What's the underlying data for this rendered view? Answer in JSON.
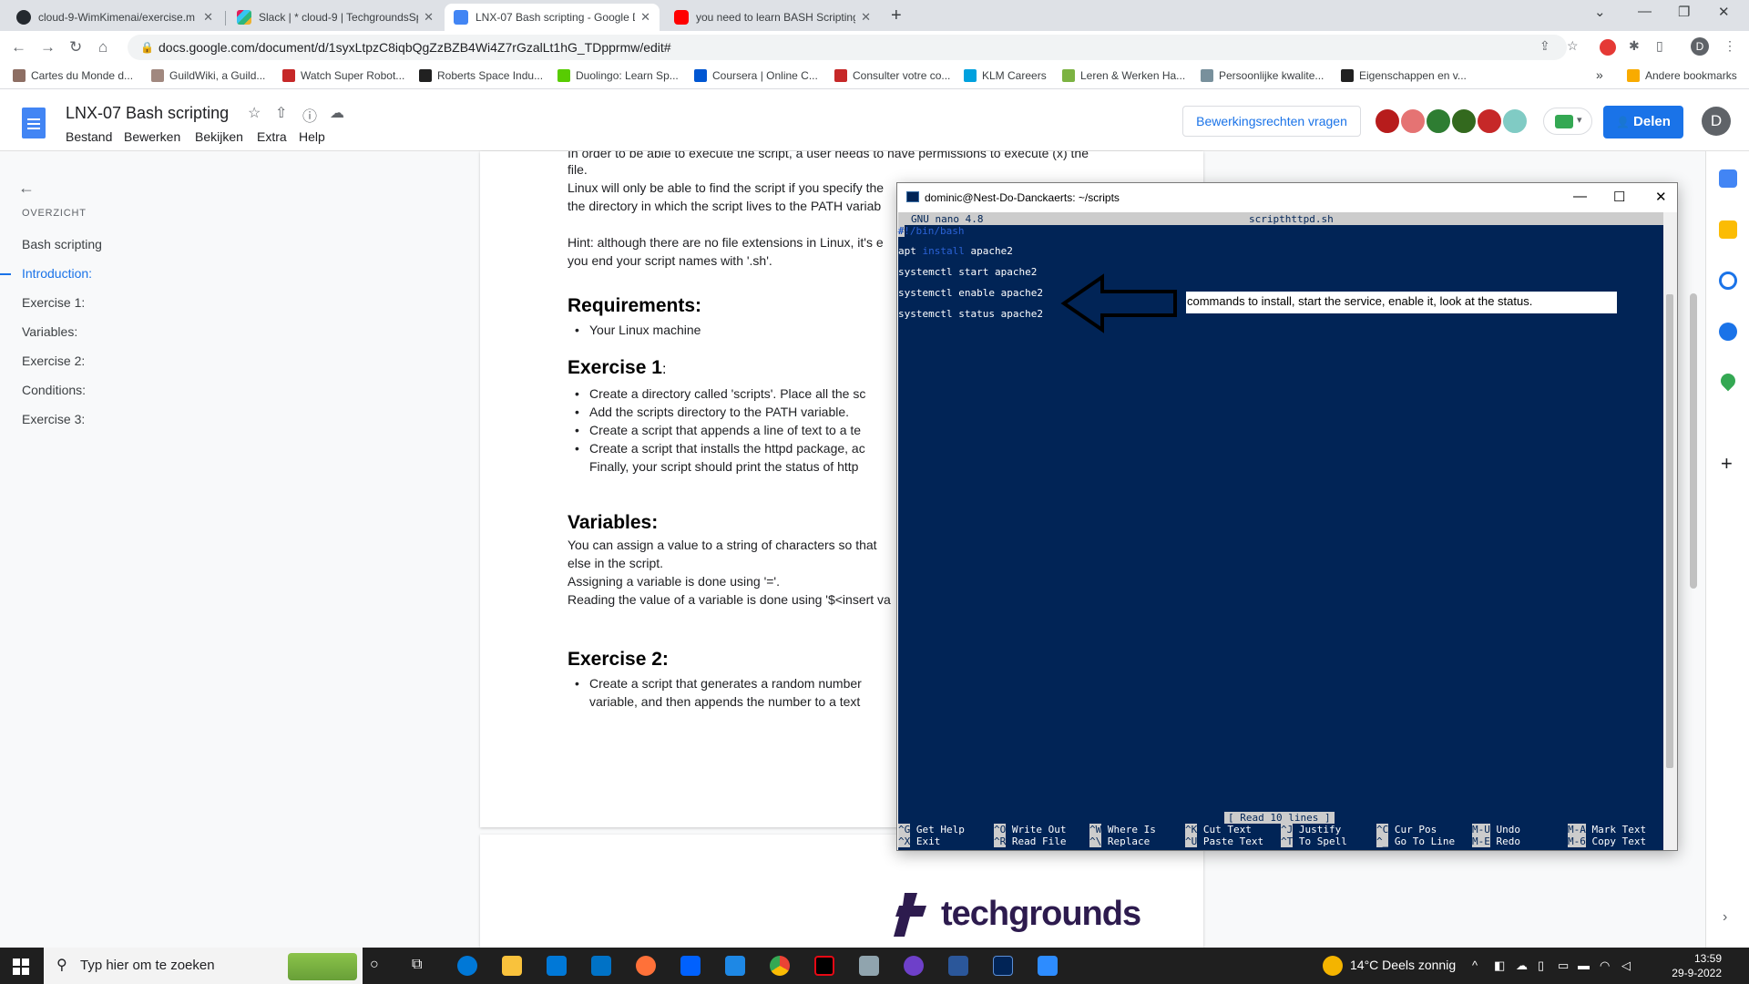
{
  "tabs": [
    {
      "title": "cloud-9-WimKimenai/exercise.m",
      "favicon_color": "#24292f"
    },
    {
      "title": "Slack | * cloud-9 | TechgroundsSp",
      "favicon_color": "#e01e5a"
    },
    {
      "title": "LNX-07 Bash scripting - Google D",
      "favicon_color": "#4285f4"
    },
    {
      "title": "you need to learn BASH Scripting",
      "favicon_color": "#ff0000"
    }
  ],
  "address": {
    "url": "docs.google.com/document/d/1syxLtpzC8iqbQgZzBZB4Wi4Z7rGzalLt1hG_TDpprmw/edit#"
  },
  "bookmarks": [
    "Cartes du Monde d...",
    "GuildWiki, a Guild...",
    "Watch Super Robot...",
    "Roberts Space Indu...",
    "Duolingo: Learn Sp...",
    "Coursera | Online C...",
    "Consulter votre co...",
    "KLM Careers",
    "Leren & Werken Ha...",
    "Persoonlijke kwalite...",
    "Eigenschappen en v..."
  ],
  "bookmarks_overflow": "»",
  "bookmarks_other": "Andere bookmarks",
  "doc": {
    "title": "LNX-07 Bash scripting",
    "menu": [
      "Bestand",
      "Bewerken",
      "Bekijken",
      "Extra",
      "Help"
    ],
    "request_edit": "Bewerkingsrechten vragen",
    "share": "Delen",
    "user_initial": "D"
  },
  "outline": {
    "heading": "OVERZICHT",
    "items": [
      "Bash scripting",
      "Introduction:",
      "Exercise 1:",
      "Variables:",
      "Exercise 2:",
      "Conditions:",
      "Exercise 3:"
    ],
    "active": "Introduction:"
  },
  "content": {
    "p1a": "In order to be able to execute the script, a user needs to have permissions to execute (x) the",
    "p1b": "file.",
    "p2a": "Linux will only be able to find the script if you specify the",
    "p2b": "the directory in which the script lives to the PATH variab",
    "p3a": "Hint: although there are no file extensions in Linux, it's e",
    "p3b": "you end your script names with '.sh'.",
    "req_head": "Requirements:",
    "req_1": "Your Linux machine",
    "ex1_head": "Exercise 1",
    "ex1_colon": ":",
    "ex1_1": "Create a directory called 'scripts'. Place all the sc",
    "ex1_2": "Add the scripts directory to the PATH variable.",
    "ex1_3": "Create a script that appends a line of text to a te",
    "ex1_4a": "Create a script that installs the httpd package, ac",
    "ex1_4b": "Finally, your script should print the status of http",
    "var_head": "Variables:",
    "var_1": "You can assign a value to a string of characters so that",
    "var_2": "else in the script.",
    "var_3": "Assigning a variable is done using '='.",
    "var_4": "Reading the value of a variable is done using '$<insert va",
    "ex2_head": "Exercise 2:",
    "ex2_1a": "Create a script that generates a random number",
    "ex2_1b": "variable, and then appends the number to a text",
    "logo": "techgrounds"
  },
  "terminal": {
    "title": "dominic@Nest-Do-Danckaerts: ~/scripts",
    "nano_version": "GNU nano 4.8",
    "filename": "scripthttpd.sh",
    "shebang": "#!/bin/bash",
    "line_apt_cmd": "apt",
    "line_apt_kw": "install",
    "line_apt_arg": "apache2",
    "line_start": "systemctl start apache2",
    "line_enable": "systemctl enable apache2",
    "line_status": "systemctl status apache2",
    "status_msg": "[ Read 10 lines ]",
    "shortcuts_row1": [
      {
        "key": "^G",
        "label": "Get Help"
      },
      {
        "key": "^O",
        "label": "Write Out"
      },
      {
        "key": "^W",
        "label": "Where Is"
      },
      {
        "key": "^K",
        "label": "Cut Text"
      },
      {
        "key": "^J",
        "label": "Justify"
      },
      {
        "key": "^C",
        "label": "Cur Pos"
      },
      {
        "key": "M-U",
        "label": "Undo"
      },
      {
        "key": "M-A",
        "label": "Mark Text"
      }
    ],
    "shortcuts_row2": [
      {
        "key": "^X",
        "label": "Exit"
      },
      {
        "key": "^R",
        "label": "Read File"
      },
      {
        "key": "^\\",
        "label": "Replace"
      },
      {
        "key": "^U",
        "label": "Paste Text"
      },
      {
        "key": "^T",
        "label": "To Spell"
      },
      {
        "key": "^_",
        "label": "Go To Line"
      },
      {
        "key": "M-E",
        "label": "Redo"
      },
      {
        "key": "M-6",
        "label": "Copy Text"
      }
    ]
  },
  "annotation": {
    "text": "commands to install, start the service, enable it, look at the status."
  },
  "taskbar": {
    "search_placeholder": "Typ hier om te zoeken",
    "weather": "14°C  Deels zonnig",
    "time": "13:59",
    "date": "29-9-2022"
  },
  "colors": {
    "accent": "#1a73e8",
    "terminal_bg": "#012456",
    "techgrounds": "#2d1b4e"
  }
}
